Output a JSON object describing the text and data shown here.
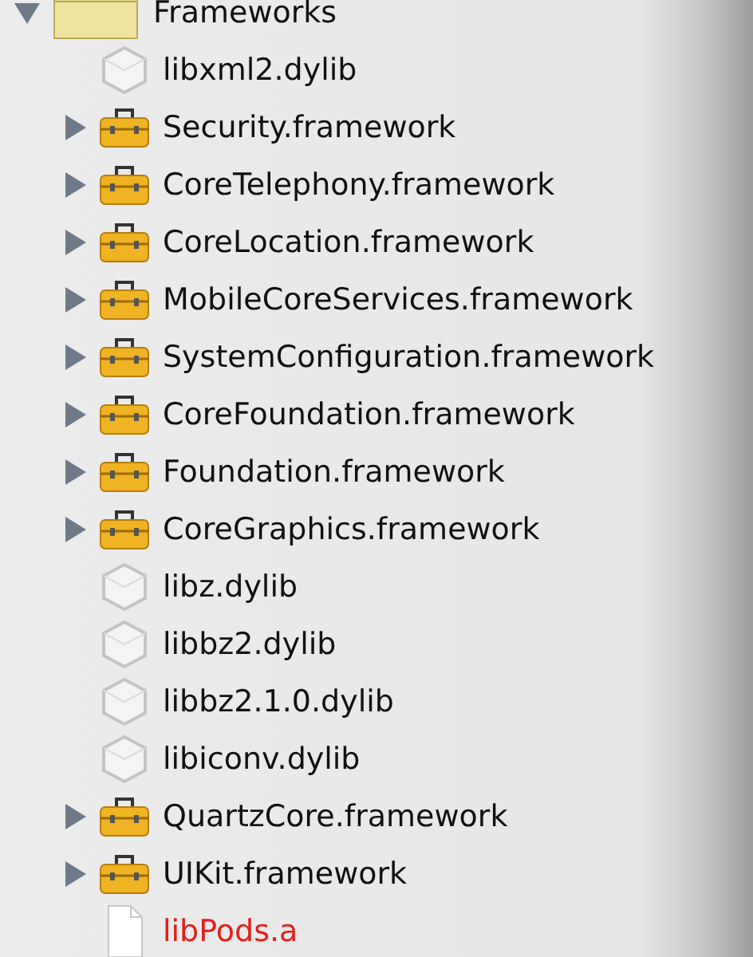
{
  "tree": [
    {
      "label": "Frameworks",
      "kind": "folder",
      "expanded": true,
      "children": [
        {
          "label": "libxml2.dylib",
          "kind": "dylib"
        },
        {
          "label": "Security.framework",
          "kind": "framework",
          "expanded": false
        },
        {
          "label": "CoreTelephony.framework",
          "kind": "framework",
          "expanded": false
        },
        {
          "label": "CoreLocation.framework",
          "kind": "framework",
          "expanded": false
        },
        {
          "label": "MobileCoreServices.framework",
          "kind": "framework",
          "expanded": false
        },
        {
          "label": "SystemConfiguration.framework",
          "kind": "framework",
          "expanded": false
        },
        {
          "label": "CoreFoundation.framework",
          "kind": "framework",
          "expanded": false
        },
        {
          "label": "Foundation.framework",
          "kind": "framework",
          "expanded": false
        },
        {
          "label": "CoreGraphics.framework",
          "kind": "framework",
          "expanded": false
        },
        {
          "label": "libz.dylib",
          "kind": "dylib"
        },
        {
          "label": "libbz2.dylib",
          "kind": "dylib"
        },
        {
          "label": "libbz2.1.0.dylib",
          "kind": "dylib"
        },
        {
          "label": "libiconv.dylib",
          "kind": "dylib"
        },
        {
          "label": "QuartzCore.framework",
          "kind": "framework",
          "expanded": false
        },
        {
          "label": "UIKit.framework",
          "kind": "framework",
          "expanded": false
        },
        {
          "label": "libPods.a",
          "kind": "file",
          "missing": true
        }
      ]
    }
  ]
}
